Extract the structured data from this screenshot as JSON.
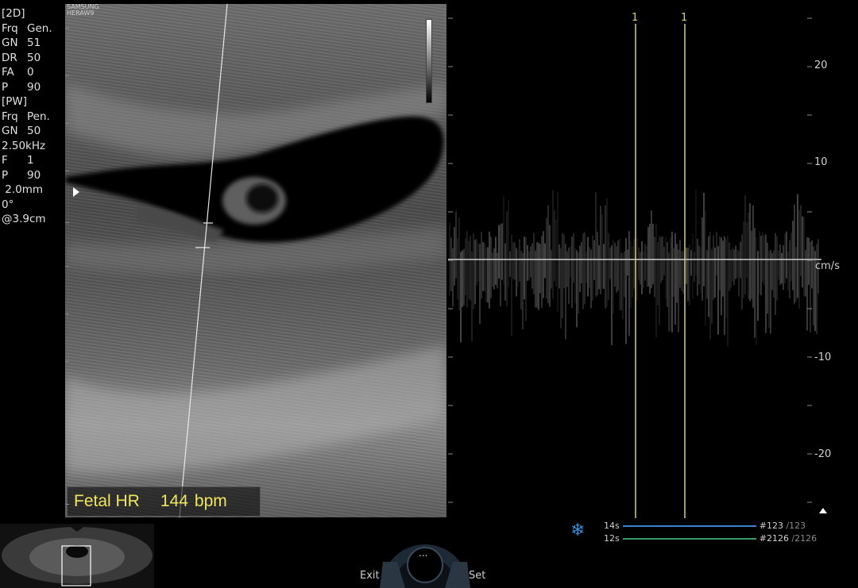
{
  "params": {
    "mode_2d": "[2D]",
    "rows_2d": [
      {
        "k": "Frq",
        "v": "Gen."
      },
      {
        "k": "GN",
        "v": "51"
      },
      {
        "k": "DR",
        "v": "50"
      },
      {
        "k": "FA",
        "v": "0"
      },
      {
        "k": "P",
        "v": "90"
      }
    ],
    "mode_pw": "[PW]",
    "rows_pw": [
      {
        "k": "Frq",
        "v": "Pen."
      },
      {
        "k": "GN",
        "v": "50"
      }
    ],
    "prf": "2.50kHz",
    "rows_pw2": [
      {
        "k": "F",
        "v": "1"
      },
      {
        "k": "P",
        "v": "90"
      }
    ],
    "gate": " 2.0mm",
    "angle": "0°",
    "depth": "@3.9cm"
  },
  "vendor": {
    "line1": "SAMSUNG",
    "line2": "HERAW9"
  },
  "fetal_hr": {
    "label": "Fetal HR",
    "value": "144",
    "unit": "bpm"
  },
  "doppler": {
    "scale_labels": [
      "20",
      "10",
      "cm/s",
      "-10",
      "-20"
    ],
    "cursor_labels": [
      "1",
      "1"
    ]
  },
  "colors": {
    "hr_text": "#f0e65a",
    "cursor": "#d6d36a",
    "freeze_icon": "#2f8fe0",
    "cine_blue": "#3a7fd0",
    "cine_green": "#3a9a6a"
  },
  "controls": {
    "exit_label": "Exit",
    "set_label": "Set",
    "dial_label": "..."
  },
  "freeze_icon": "snowflake-icon",
  "cine": [
    {
      "time": "14s",
      "frame": "#123",
      "total": "/123"
    },
    {
      "time": "12s",
      "frame": "#2126",
      "total": "/2126"
    }
  ]
}
